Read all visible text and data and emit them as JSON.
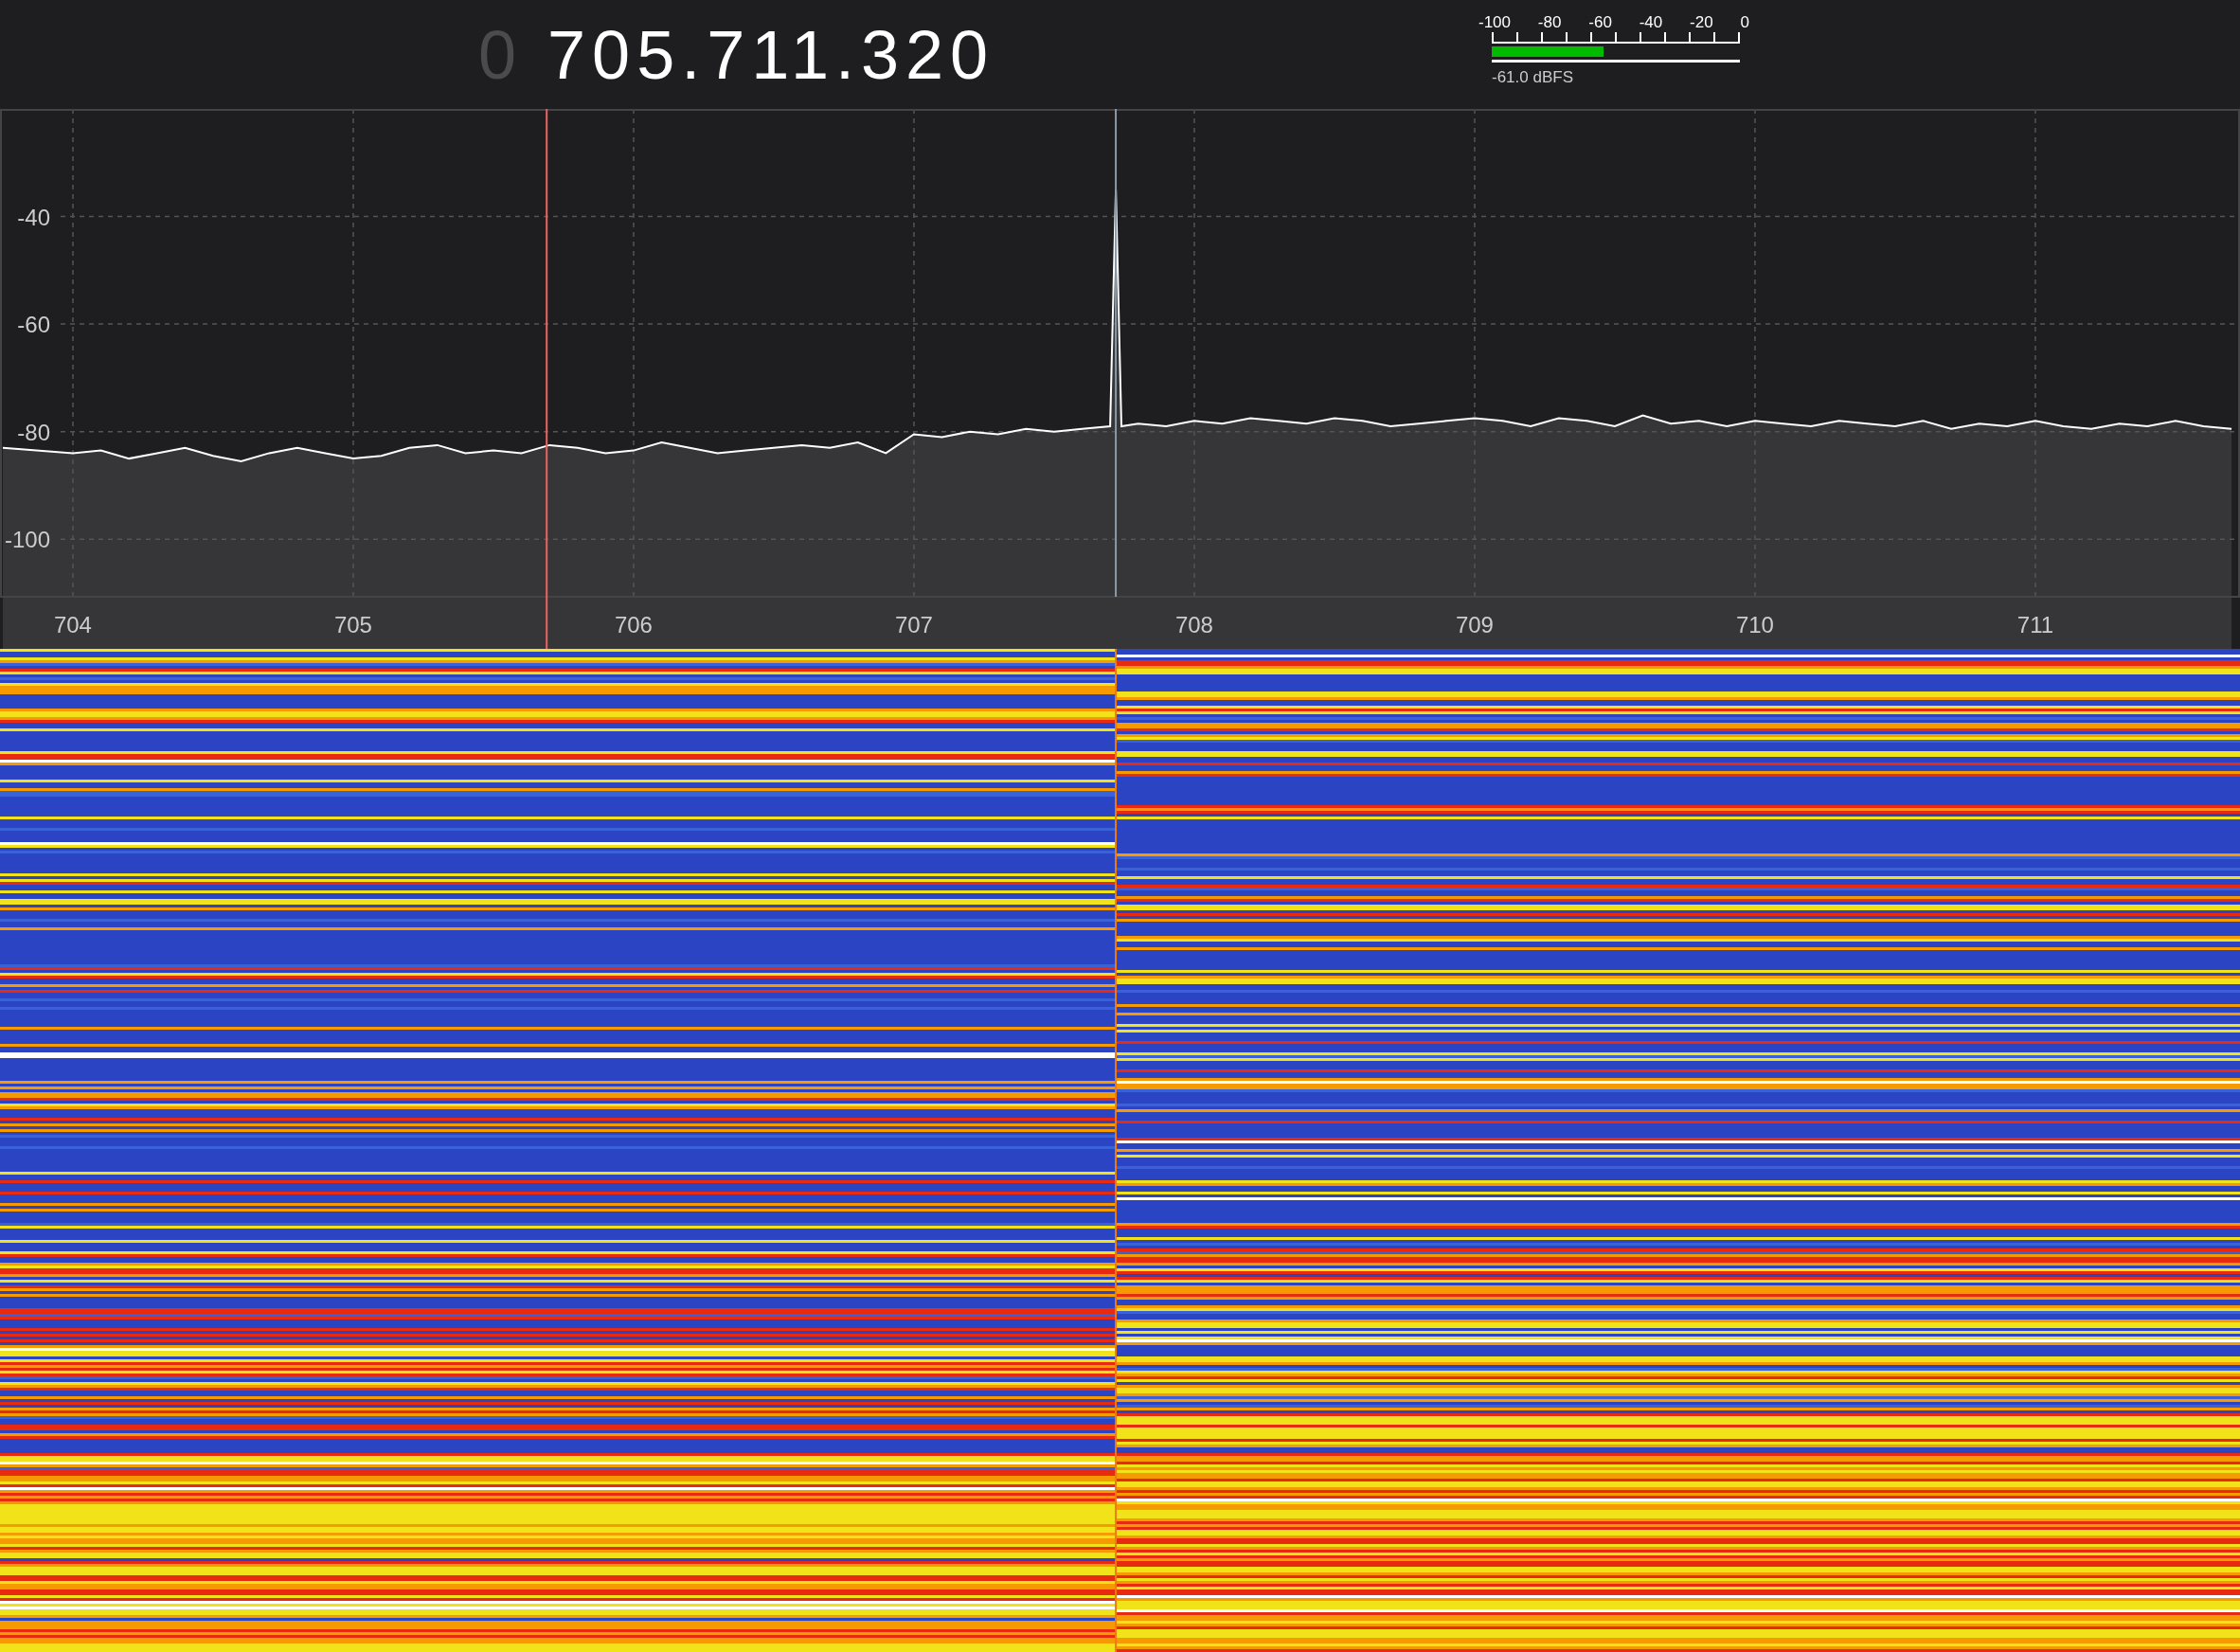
{
  "frequency": {
    "leading_digit": "0",
    "value": "705.711.320"
  },
  "signal_meter": {
    "scale": [
      "-100",
      "-80",
      "-60",
      "-40",
      "-20",
      "0"
    ],
    "level": 0.45,
    "reading": "-61.0 dBFS"
  },
  "spectrum": {
    "chart_data": {
      "type": "area",
      "x": [
        703.75,
        704.0,
        704.1,
        704.2,
        704.3,
        704.4,
        704.5,
        704.6,
        704.7,
        704.8,
        704.9,
        705.0,
        705.1,
        705.2,
        705.3,
        705.4,
        705.5,
        705.6,
        705.7,
        705.8,
        705.9,
        706.0,
        706.1,
        706.2,
        706.3,
        706.4,
        706.5,
        706.6,
        706.7,
        706.8,
        706.9,
        707.0,
        707.1,
        707.2,
        707.3,
        707.4,
        707.5,
        707.6,
        707.7,
        707.72,
        707.74,
        707.8,
        707.9,
        708.0,
        708.1,
        708.2,
        708.3,
        708.4,
        708.5,
        708.6,
        708.7,
        708.8,
        708.9,
        709.0,
        709.1,
        709.2,
        709.3,
        709.4,
        709.5,
        709.6,
        709.7,
        709.8,
        709.9,
        710.0,
        710.1,
        710.2,
        710.3,
        710.4,
        710.5,
        710.6,
        710.7,
        710.8,
        710.9,
        711.0,
        711.1,
        711.2,
        711.3,
        711.4,
        711.5,
        711.6,
        711.7
      ],
      "series": [
        {
          "color": "#ffffff",
          "values": [
            -83,
            -84,
            -83.5,
            -85,
            -84,
            -83,
            -84.5,
            -85.5,
            -84,
            -83,
            -84,
            -85,
            -84.5,
            -83,
            -82.5,
            -84,
            -83.5,
            -84,
            -82.5,
            -83,
            -84,
            -83.5,
            -82,
            -83,
            -84,
            -83.5,
            -83,
            -82.5,
            -83,
            -82,
            -84,
            -80.5,
            -81,
            -80,
            -80.5,
            -79.5,
            -80,
            -79.5,
            -79,
            -35,
            -79,
            -78.5,
            -79,
            -78,
            -78.5,
            -77.5,
            -78,
            -78.5,
            -77.5,
            -78,
            -79,
            -78.5,
            -78,
            -77.5,
            -78,
            -79,
            -77.5,
            -78,
            -79,
            -77,
            -78.5,
            -78,
            -79,
            -78,
            -78.5,
            -79,
            -78,
            -78.5,
            -79,
            -78,
            -79.5,
            -78.5,
            -79,
            -78,
            -79,
            -79.5,
            -78.5,
            -79,
            -78,
            -79,
            -79.5
          ]
        }
      ],
      "xlim": [
        703.74,
        711.73
      ],
      "ylim": [
        -110.7,
        -20
      ],
      "xticks": [
        704,
        705,
        706,
        707,
        708,
        709,
        710,
        711
      ],
      "yticks": [
        -40,
        -60,
        -80,
        -100
      ],
      "grid": true
    }
  }
}
